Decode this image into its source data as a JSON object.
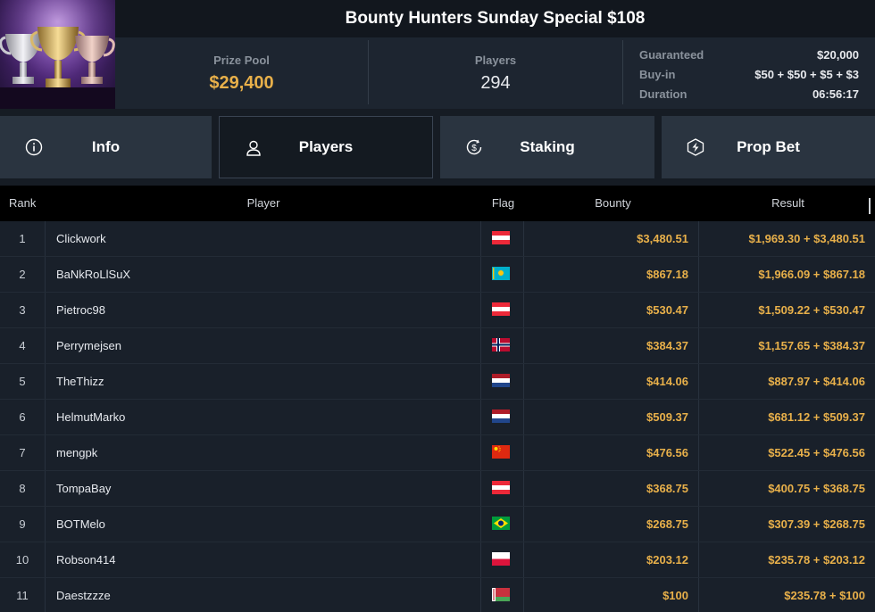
{
  "header": {
    "title": "Bounty Hunters Sunday Special $108",
    "prize_pool": {
      "label": "Prize Pool",
      "value": "$29,400"
    },
    "players": {
      "label": "Players",
      "value": "294"
    },
    "details": [
      {
        "label": "Guaranteed",
        "value": "$20,000"
      },
      {
        "label": "Buy-in",
        "value": "$50 + $50 + $5 + $3"
      },
      {
        "label": "Duration",
        "value": "06:56:17"
      }
    ]
  },
  "tabs": [
    {
      "label": "Info",
      "icon": "info-icon",
      "active": false
    },
    {
      "label": "Players",
      "icon": "user-icon",
      "active": true
    },
    {
      "label": "Staking",
      "icon": "dollar-coin-icon",
      "active": false
    },
    {
      "label": "Prop Bet",
      "icon": "lightning-icon",
      "active": false
    }
  ],
  "table": {
    "columns": {
      "rank": "Rank",
      "player": "Player",
      "flag": "Flag",
      "bounty": "Bounty",
      "result": "Result"
    },
    "rows": [
      {
        "rank": "1",
        "player": "Clickwork",
        "flag": "AT",
        "bounty": "$3,480.51",
        "result": "$1,969.30 + $3,480.51"
      },
      {
        "rank": "2",
        "player": "BaNkRoLlSuX",
        "flag": "KZ",
        "bounty": "$867.18",
        "result": "$1,966.09 + $867.18"
      },
      {
        "rank": "3",
        "player": "Pietroc98",
        "flag": "AT",
        "bounty": "$530.47",
        "result": "$1,509.22 + $530.47"
      },
      {
        "rank": "4",
        "player": "Perrymejsen",
        "flag": "NO",
        "bounty": "$384.37",
        "result": "$1,157.65 + $384.37"
      },
      {
        "rank": "5",
        "player": "TheThizz",
        "flag": "NL",
        "bounty": "$414.06",
        "result": "$887.97 + $414.06"
      },
      {
        "rank": "6",
        "player": "HelmutMarko",
        "flag": "NL",
        "bounty": "$509.37",
        "result": "$681.12 + $509.37"
      },
      {
        "rank": "7",
        "player": "mengpk",
        "flag": "CN",
        "bounty": "$476.56",
        "result": "$522.45 + $476.56"
      },
      {
        "rank": "8",
        "player": "TompaBay",
        "flag": "AT",
        "bounty": "$368.75",
        "result": "$400.75 + $368.75"
      },
      {
        "rank": "9",
        "player": "BOTMelo",
        "flag": "BR",
        "bounty": "$268.75",
        "result": "$307.39 + $268.75"
      },
      {
        "rank": "10",
        "player": "Robson414",
        "flag": "PL",
        "bounty": "$203.12",
        "result": "$235.78 + $203.12"
      },
      {
        "rank": "11",
        "player": "Daestzzze",
        "flag": "BY",
        "bounty": "$100",
        "result": "$235.78 + $100"
      }
    ]
  },
  "colors": {
    "accent_gold": "#e8b04a",
    "background": "#161c24",
    "header_bg": "#1d2530",
    "tab_bg": "#2a3440",
    "row_bg": "#19202a"
  }
}
